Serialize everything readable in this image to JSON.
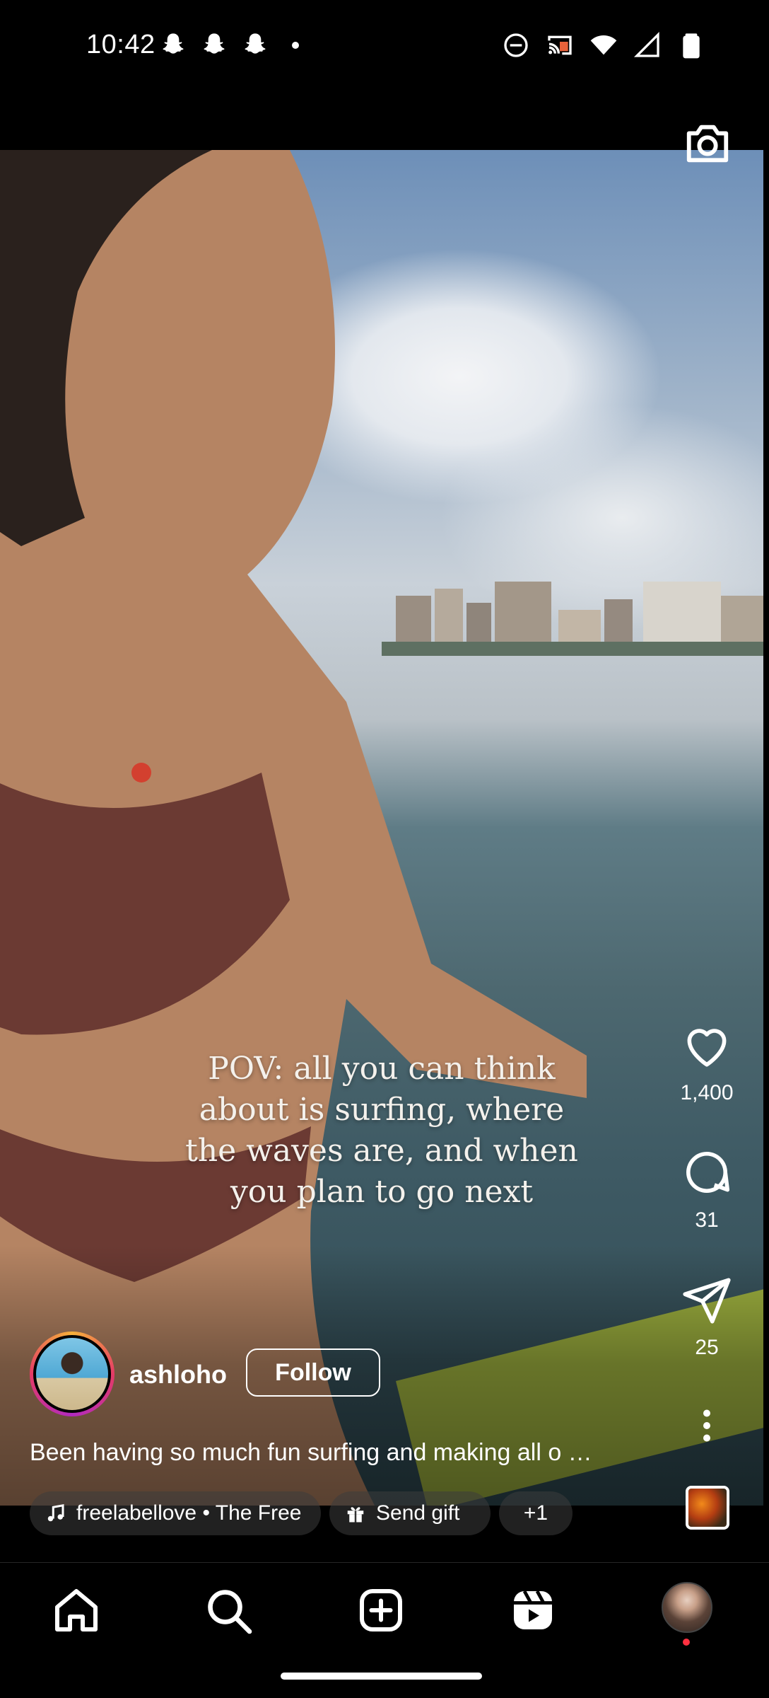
{
  "status_bar": {
    "time": "10:42",
    "left_icons": [
      "snapchat-icon",
      "snapchat-icon",
      "snapchat-icon",
      "dot-icon"
    ],
    "right_icons": [
      "do-not-disturb-icon",
      "cast-icon",
      "wifi-icon",
      "cellular-signal-icon",
      "battery-icon"
    ]
  },
  "reel": {
    "overlay_text": "POV: all you can think about is surfing, where the waves are, and when you plan to go next",
    "author": {
      "username": "ashloho",
      "follow_label": "Follow"
    },
    "caption": "Been having so much fun surfing and making all o …",
    "actions": {
      "likes": "1,400",
      "comments": "31",
      "shares": "25"
    },
    "chips": {
      "music": "freelabellove • The Free",
      "gift": "Send gift",
      "more": "+1"
    }
  },
  "nav": {
    "items": [
      "home-icon",
      "search-icon",
      "create-icon",
      "reels-icon",
      "profile-avatar"
    ]
  },
  "colors": {
    "background": "#000000",
    "notification_dot": "#ff3040",
    "ring_gradient": [
      "#f6b13a",
      "#e43b66",
      "#b12abf"
    ]
  }
}
